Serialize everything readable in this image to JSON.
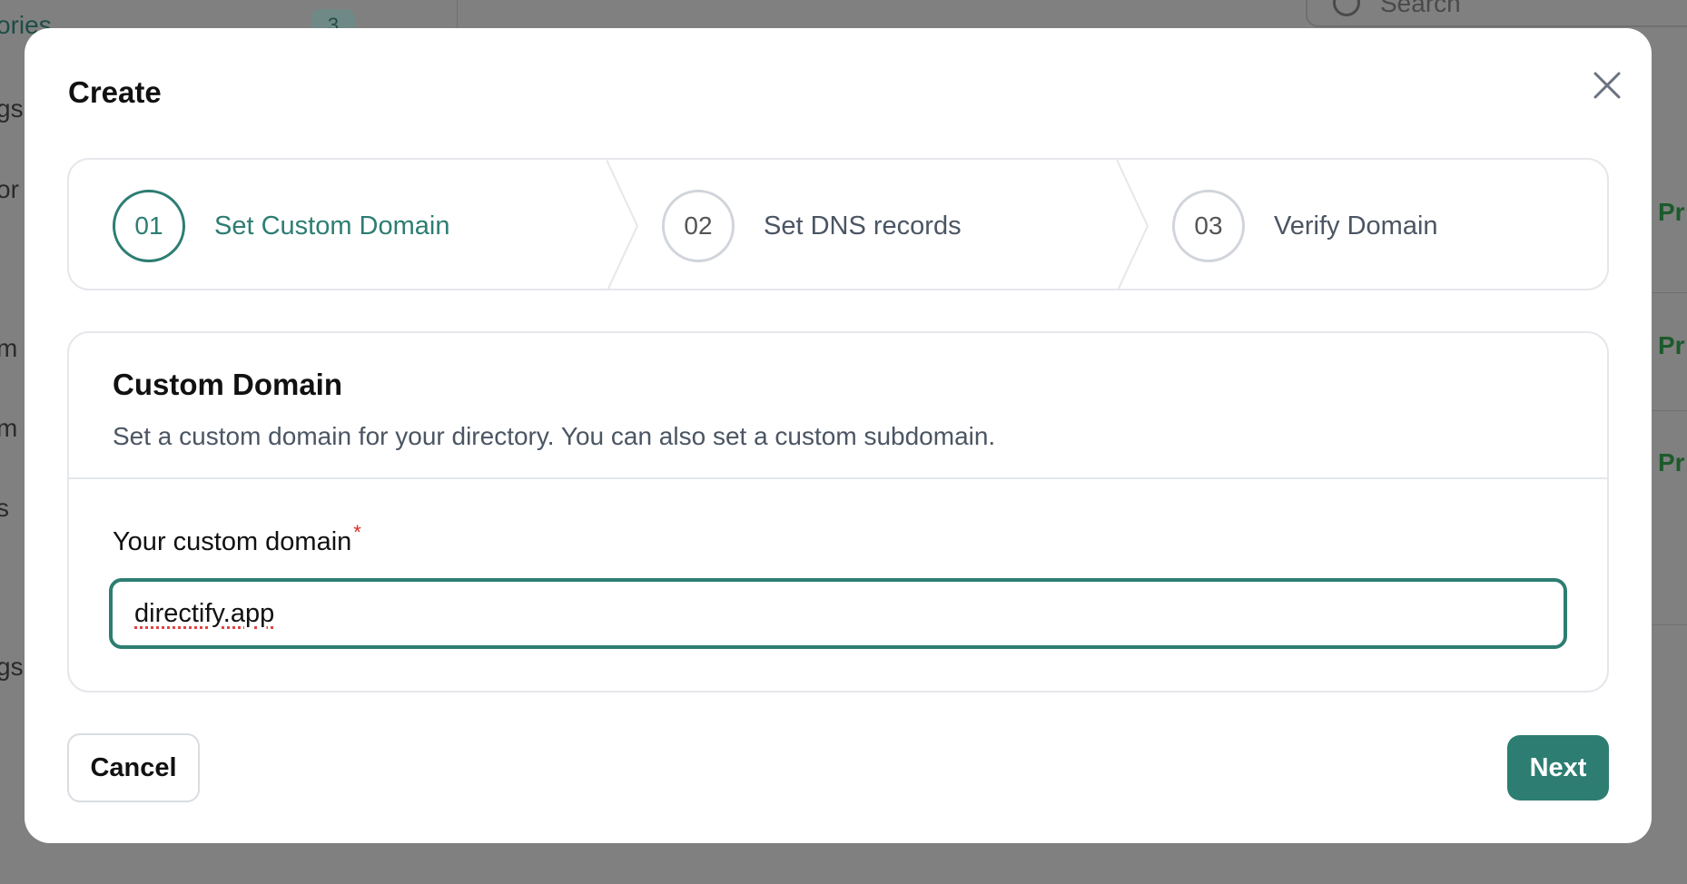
{
  "background": {
    "sidebar_fragments": [
      "ories",
      "gs",
      "or",
      "m",
      "m",
      "s",
      "gs"
    ],
    "badge_count": "3",
    "search_placeholder": "Search",
    "pro_labels": [
      "Pr",
      "Pr",
      "Pr"
    ]
  },
  "modal": {
    "title": "Create",
    "close_icon": "close-icon"
  },
  "stepper": {
    "steps": [
      {
        "number": "01",
        "label": "Set Custom Domain",
        "active": true
      },
      {
        "number": "02",
        "label": "Set DNS records",
        "active": false
      },
      {
        "number": "03",
        "label": "Verify Domain",
        "active": false
      }
    ]
  },
  "card": {
    "title": "Custom Domain",
    "description": "Set a custom domain for your directory. You can also set a custom subdomain.",
    "field_label": "Your custom domain",
    "required_marker": "*",
    "input_value": "directify.app"
  },
  "footer": {
    "cancel_label": "Cancel",
    "next_label": "Next"
  },
  "colors": {
    "accent": "#2d7d72",
    "required": "#dc2626"
  }
}
